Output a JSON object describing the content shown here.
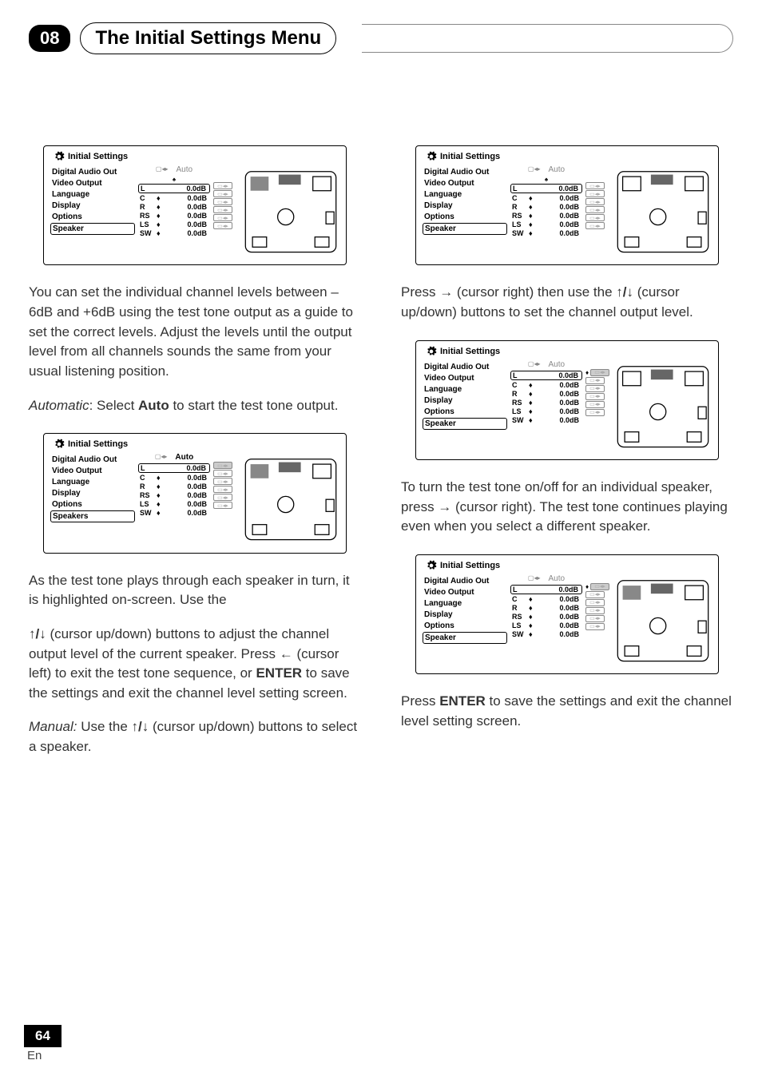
{
  "header": {
    "chapter": "08",
    "title": "The Initial Settings Menu"
  },
  "panel_common": {
    "title": "Initial Settings",
    "menu": [
      "Digital Audio Out",
      "Video Output",
      "Language",
      "Display",
      "Options"
    ],
    "channels": [
      "L",
      "C",
      "R",
      "RS",
      "LS",
      "SW"
    ],
    "value": "0.0dB",
    "auto": "Auto",
    "last_item_a": "Speaker",
    "last_item_b": "Speakers"
  },
  "text": {
    "p1": "You can set the individual channel levels between –6dB and +6dB using the test tone output as a guide to set the correct levels. Adjust the levels until the output level from all channels sounds the same from your usual listening position.",
    "p2a": "Automatic",
    "p2b": ": Select ",
    "p2c": "Auto",
    "p2d": " to start the test tone output.",
    "p3": "As the test tone plays through each speaker in turn, it is highlighted on-screen. Use the",
    "p4a": " (cursor up/down) buttons to adjust the channel output level of the current speaker. Press ",
    "p4b": " (cursor left) to exit the test tone sequence, or ",
    "p4c": "ENTER",
    "p4d": " to save the settings and exit the channel level setting screen.",
    "p5a": "Manual:",
    "p5b": " Use the ",
    "p5c": " (cursor up/down) buttons to select a speaker.",
    "p6a": "Press ",
    "p6b": " (cursor right) then use the ",
    "p6c": " (cursor up/down) buttons to set the channel output level.",
    "p7": "To turn the test tone on/off for an individual speaker, press ",
    "p7b": " (cursor right). The test tone continues playing even when you select a different speaker.",
    "p8a": "Press ",
    "p8b": "ENTER",
    "p8c": " to save the settings and exit the channel level setting screen."
  },
  "footer": {
    "page": "64",
    "lang": "En"
  }
}
